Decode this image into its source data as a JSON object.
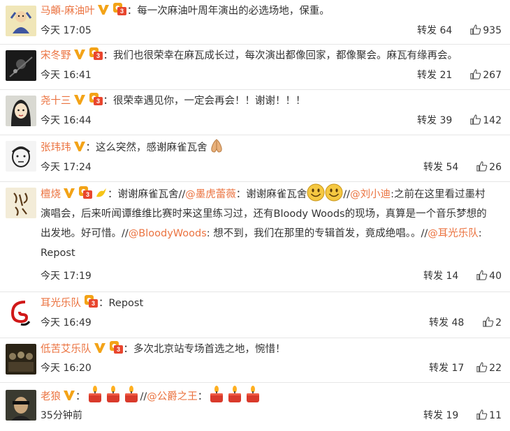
{
  "colors": {
    "username": "#eb7340",
    "text": "#333333",
    "divider": "#e6e6e6",
    "vip_badge": "#f3a317",
    "level_badge": "#e8462f"
  },
  "comments": [
    {
      "user": "马頔-麻油叶",
      "text": "：每一次麻油叶周年演出的必选场地，保重。",
      "time": "今天 17:05",
      "forward": "转发 64",
      "likes": "935",
      "avatar": "avatar-cartoon-figure"
    },
    {
      "user": "宋冬野",
      "text": "：我们也很荣幸在麻瓦成长过，每次演出都像回家，都像聚会。麻瓦有缘再会。",
      "time": "今天 16:41",
      "forward": "转发 21",
      "likes": "267",
      "avatar": "avatar-dark-photo"
    },
    {
      "user": "尧十三",
      "text": "：很荣幸遇见你，一定会再会！！谢谢！！！",
      "time": "今天 16:44",
      "forward": "转发 39",
      "likes": "142",
      "avatar": "avatar-cartoon-face"
    },
    {
      "user": "张玮玮",
      "text": "：这么突然，感谢麻雀瓦舍",
      "time": "今天 17:24",
      "forward": "转发 54",
      "likes": "26",
      "avatar": "avatar-sketch-face"
    },
    {
      "user": "檀烧",
      "t1": "：谢谢麻雀瓦舍//",
      "m1": "@墨虎蕾薇",
      "t2": "：谢谢麻雀瓦舍",
      "t3": "//",
      "m2": "@刘小迪",
      "t4": ":之前在这里看过墨村演唱会，后来听闻谭维维比赛时来这里练习过，还有Bloody Woods的现场，真算是一个音乐梦想的出发地。好可惜。//",
      "m3": "@BloodyWoods",
      "t5": ": 想不到，我们在那里的专辑首发，竟成绝唱。。//",
      "m4": "@耳光乐队",
      "t6": ":",
      "t7": "Repost",
      "time": "今天 17:19",
      "forward": "转发 14",
      "likes": "40",
      "avatar": "avatar-calligraphy"
    },
    {
      "user": "耳光乐队",
      "text": "：Repost",
      "time": "今天 16:49",
      "forward": "转发 48",
      "likes": "2",
      "avatar": "avatar-ear-logo"
    },
    {
      "user": "低苦艾乐队",
      "text": "：多次北京站专场首选之地，惋惜！",
      "time": "今天 16:20",
      "forward": "转发 17",
      "likes": "22",
      "avatar": "avatar-band-photo"
    },
    {
      "user": "老狼",
      "t1": "：",
      "t2": "//",
      "m1": "@公爵之王",
      "t3": "：",
      "time": "35分钟前",
      "forward": "转发 19",
      "likes": "11",
      "avatar": "avatar-portrait"
    }
  ]
}
